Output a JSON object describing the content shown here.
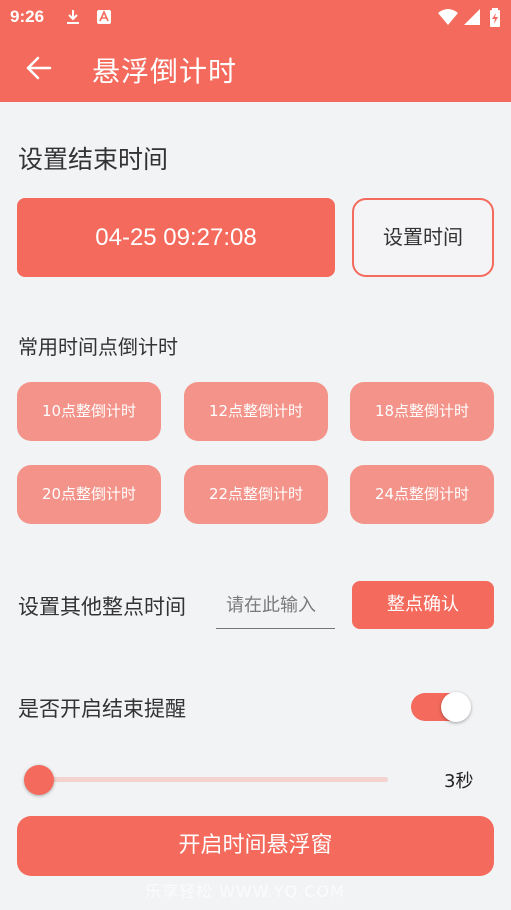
{
  "status_bar": {
    "time": "9:26",
    "icons": [
      "download-icon",
      "font-icon",
      "wifi-icon",
      "signal-icon",
      "battery-charging-icon"
    ]
  },
  "app_bar": {
    "back_icon": "arrow-left-icon",
    "title": "悬浮倒计时"
  },
  "end_time": {
    "section_title": "设置结束时间",
    "display_value": "04-25 09:27:08",
    "set_button_label": "设置时间"
  },
  "presets": {
    "title": "常用时间点倒计时",
    "items": [
      {
        "label": "10点整倒计时"
      },
      {
        "label": "12点整倒计时"
      },
      {
        "label": "18点整倒计时"
      },
      {
        "label": "20点整倒计时"
      },
      {
        "label": "22点整倒计时"
      },
      {
        "label": "24点整倒计时"
      }
    ]
  },
  "other_hour": {
    "label": "设置其他整点时间",
    "input_placeholder": "请在此输入",
    "input_value": "",
    "confirm_label": "整点确认"
  },
  "reminder": {
    "label": "是否开启结束提醒",
    "enabled": true
  },
  "slider": {
    "value_label": "3秒",
    "fraction": 0.0
  },
  "start_button_label": "开启时间悬浮窗",
  "watermark": "乐享轻松 WWW.YQ.COM",
  "colors": {
    "accent": "#f46a5c",
    "preset_button": "#f39389",
    "background": "#f2f3f5",
    "slider_track": "#f3d2cf"
  }
}
